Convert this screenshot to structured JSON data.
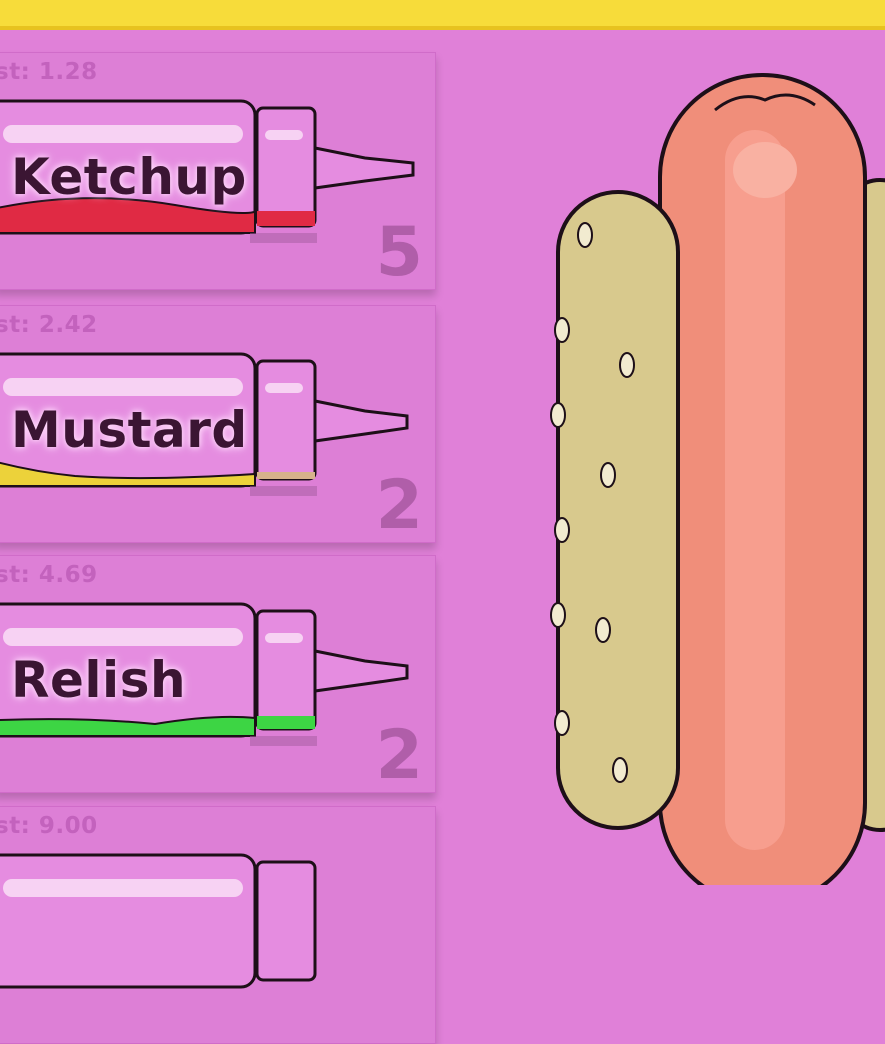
{
  "colors": {
    "background": "#e080d8",
    "topbar": "#f7dc3a",
    "panel": "#dd7fd6"
  },
  "condiments": [
    {
      "name": "Ketchup",
      "cost": "st: 1.28",
      "count": "5",
      "fill_color": "#e02a44",
      "fill_level": 0.15
    },
    {
      "name": "Mustard",
      "cost": "st: 2.42",
      "count": "2",
      "fill_color": "#ecd23a",
      "fill_level": 0.05
    },
    {
      "name": "Relish",
      "cost": "st: 4.69",
      "count": "2",
      "fill_color": "#3dd544",
      "fill_level": 0.1
    },
    {
      "name": "",
      "cost": "st: 9.00",
      "count": "",
      "fill_color": "#e080d8",
      "fill_level": 0
    }
  ],
  "hotdog": {
    "icon": "hotdog-icon"
  }
}
